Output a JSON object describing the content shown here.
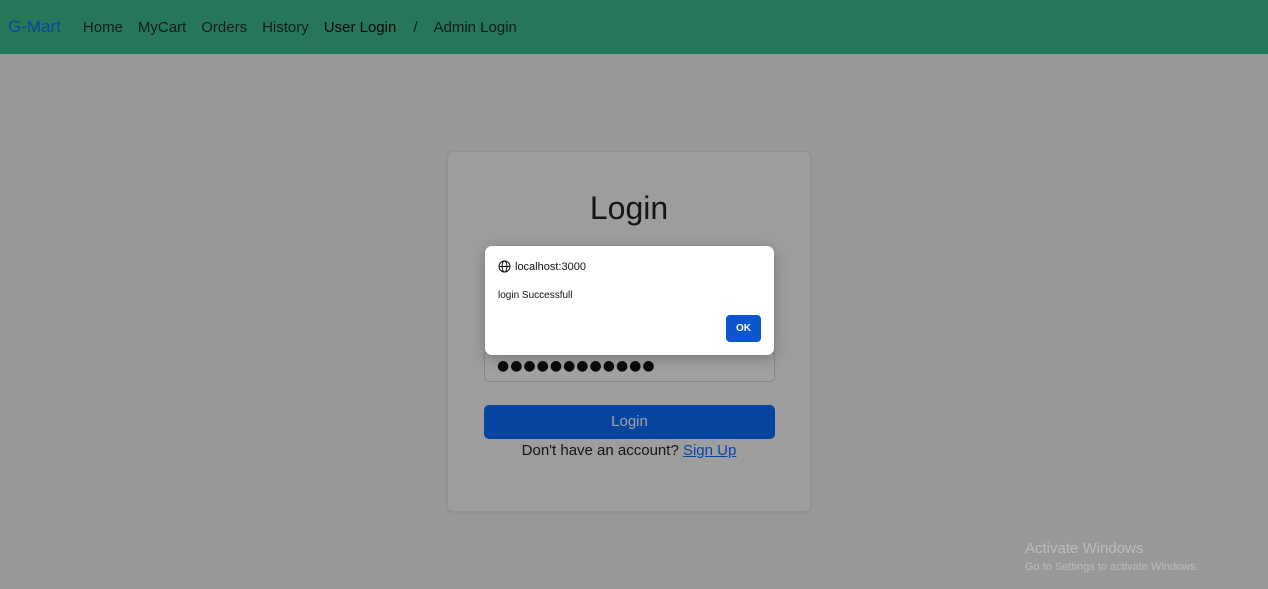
{
  "nav": {
    "brand": "G-Mart",
    "links": [
      "Home",
      "MyCart",
      "Orders",
      "History",
      "User Login"
    ],
    "separator": "/",
    "admin": "Admin Login"
  },
  "login": {
    "title": "Login",
    "password_masked": "●●●●●●●●●●●●",
    "submit_label": "Login",
    "signup_prompt": "Don't have an account?",
    "signup_link": "Sign Up"
  },
  "dialog": {
    "origin": "localhost:3000",
    "message": "login Successfull",
    "ok_label": "OK"
  },
  "watermark": {
    "title": "Activate Windows",
    "subtitle": "Go to Settings to activate Windows."
  },
  "colors": {
    "navbar": "#3dbd8e",
    "brand": "#0d6efd",
    "primary_button": "#0d6efd",
    "dialog_ok": "#0b57d0"
  }
}
